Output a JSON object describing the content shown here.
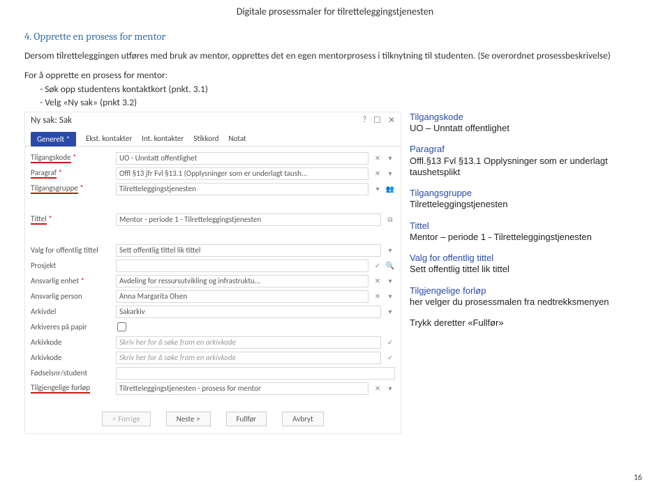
{
  "doc_header": "Digitale prosessmaler for tilretteleggingstjenesten",
  "section_title": "4. Opprette en prosess for mentor",
  "intro_para": "Dersom tilretteleggingen utføres med bruk av mentor, opprettes det en egen mentorprosess i tilknytning til studenten. (Se overordnet prosessbeskrivelse)",
  "steps_intro": "For å opprette en prosess for mentor:",
  "step1": "Søk opp studentens kontaktkort (pnkt. 3.1)",
  "step2": "Velg «Ny sak» (pnkt 3.2)",
  "shot": {
    "title": "Ny sak: Sak",
    "tabs": [
      "Generelt *",
      "Ekst. kontakter",
      "Int. kontakter",
      "Stikkord",
      "Notat"
    ],
    "rows": {
      "tilgangskode_label": "Tilgangskode",
      "tilgangskode_val": "UO - Unntatt offentlighet",
      "paragraf_label": "Paragraf",
      "paragraf_val": "Offl §13 jfr Fvl §13.1 (Opplysninger som er underlagt taush...",
      "tilgangsgruppe_label": "Tilgangsgruppe",
      "tilgangsgruppe_val": "Tilretteleggingstjenesten",
      "tittel_label": "Tittel",
      "tittel_val": "Mentor - periode 1 - Tilretteleggingstjenesten",
      "offtitle_label": "Valg for offentlig tittel",
      "offtitle_val": "Sett offentlig tittel lik tittel",
      "prosjekt_label": "Prosjekt",
      "ansvarlig_enhet_label": "Ansvarlig enhet",
      "ansvarlig_enhet_val": "Avdeling for ressursutvikling og infrastruktu...",
      "ansvarlig_person_label": "Ansvarlig person",
      "ansvarlig_person_val": "Anna Margarita Olsen",
      "arkivdel_label": "Arkivdel",
      "arkivdel_val": "Sakarkiv",
      "arkiv_papir_label": "Arkiveres på papir",
      "arkivkode_label": "Arkivkode",
      "arkivkode_ph": "Skriv her for å søke fram en arkivkode",
      "arkivkode2_label": "Arkivkode",
      "fodsel_label": "Fødselsnr/student",
      "forlop_label": "Tilgjengelige forløp",
      "forlop_val": "Tilretteleggingstjenesten - prosess for mentor"
    },
    "buttons": {
      "prev": "< Forrige",
      "next": "Neste >",
      "finish": "Fullfør",
      "cancel": "Avbryt"
    }
  },
  "notes": {
    "n1t": "Tilgangskode",
    "n1": "UO – Unntatt offentlighet",
    "n2t": "Paragraf",
    "n2": "Offl.§13 Fvl §13.1 Opplysninger som er underlagt taushetsplikt",
    "n3t": "Tilgangsgruppe",
    "n3": "Tilretteleggingstjenesten",
    "n4t": "Tittel",
    "n4": "Mentor – periode 1 - Tilretteleggingstjenesten",
    "n5t": "Valg for offentlig tittel",
    "n5": "Sett offentlig tittel lik tittel",
    "n6t": "Tilgjengelige forløp",
    "n6": "her velger du prosessmalen fra nedtrekksmenyen",
    "n7": "Trykk deretter «Fullfør»"
  },
  "page_num": "16"
}
